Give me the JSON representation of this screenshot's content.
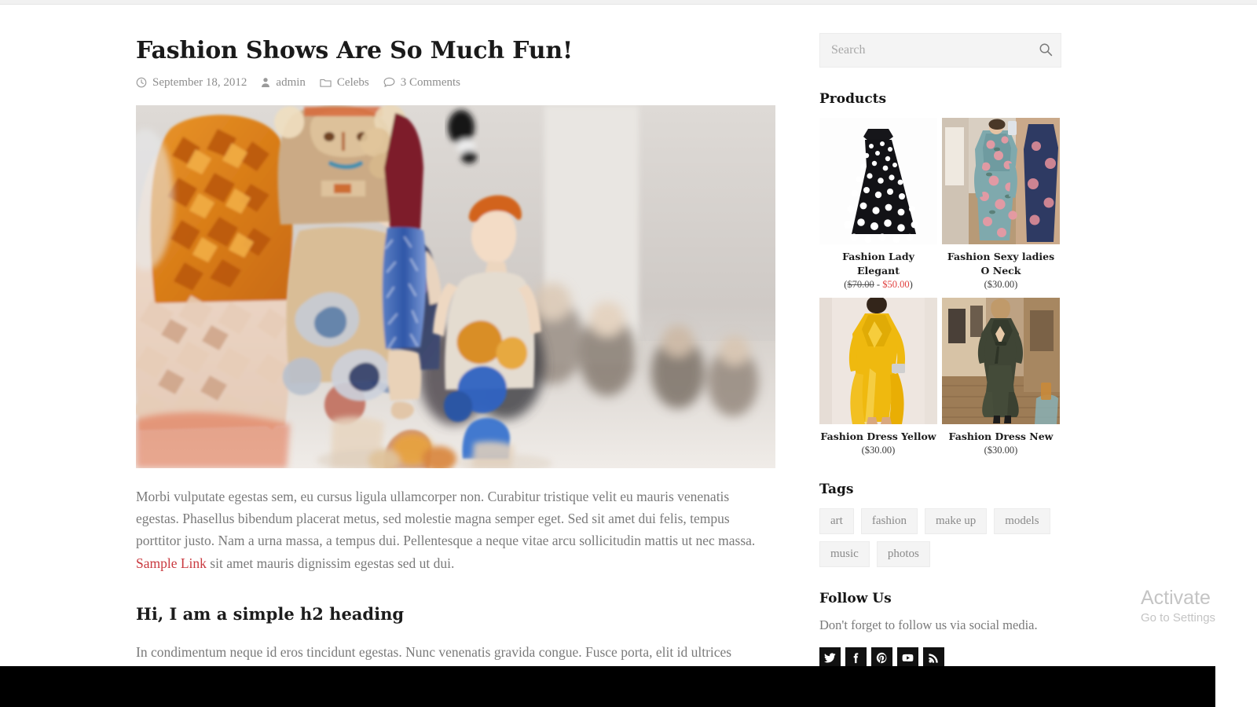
{
  "post": {
    "title": "Fashion Shows Are So Much Fun!",
    "meta": {
      "date": "September 18, 2012",
      "author": "admin",
      "category": "Celebs",
      "comments": "3 Comments",
      "date_icon": "clock-icon",
      "author_icon": "user-icon",
      "category_icon": "folder-icon",
      "comments_icon": "comment-icon"
    },
    "featured_image_alt": "Models walking on a fashion show runway",
    "paragraph_1_before_link": "Morbi vulputate egestas sem, eu cursus ligula ullamcorper non. Curabitur tristique velit eu mauris venenatis egestas. Phasellus bibendum placerat metus, sed molestie magna semper eget. Sed sit amet dui felis, tempus porttitor justo. Nam a urna massa, a tempus dui. Pellentesque a neque vitae arcu sollicitudin mattis ut nec massa. ",
    "paragraph_1_link": "Sample Link",
    "paragraph_1_after_link": " sit amet mauris dignissim egestas sed ut dui.",
    "heading_2": "Hi, I am a simple h2 heading",
    "paragraph_2": "In condimentum neque id eros tincidunt egestas. Nunc venenatis gravida congue. Fusce porta, elit id ultrices bibendum, lectus velit tristique massa, nec bibendum felis ante et metus. Vestibulum ultrices adipiscing turpis quis feugiat. Cras sed"
  },
  "sidebar": {
    "search": {
      "placeholder": "Search",
      "value": "",
      "icon": "search-icon"
    },
    "products": {
      "title": "Products",
      "items": [
        {
          "name": "Fashion Lady Elegant",
          "price_old": "$70.00",
          "price_sep": " - ",
          "price_new": "$50.00",
          "price_open": "(",
          "price_close": ")",
          "on_sale": true,
          "image": "black-white-polka-dot-dress"
        },
        {
          "name": "Fashion Sexy ladies O Neck",
          "price": "($30.00)",
          "on_sale": false,
          "image": "teal-floral-maxi-dress"
        },
        {
          "name": "Fashion Dress Yellow",
          "price": "($30.00)",
          "on_sale": false,
          "image": "yellow-maxi-dress"
        },
        {
          "name": "Fashion Dress New",
          "price": "($30.00)",
          "on_sale": false,
          "image": "olive-green-dress"
        }
      ]
    },
    "tags": {
      "title": "Tags",
      "items": [
        "art",
        "fashion",
        "make up",
        "models",
        "music",
        "photos"
      ]
    },
    "follow": {
      "title": "Follow Us",
      "text": "Don't forget to follow us via social media.",
      "socials": [
        {
          "name": "twitter-icon",
          "label": "Twitter"
        },
        {
          "name": "facebook-icon",
          "label": "Facebook"
        },
        {
          "name": "pinterest-icon",
          "label": "Pinterest"
        },
        {
          "name": "youtube-icon",
          "label": "YouTube"
        },
        {
          "name": "rss-icon",
          "label": "RSS"
        }
      ]
    }
  },
  "watermark": {
    "line1": "Activate Windows",
    "line2": "Go to Settings to activate Windows."
  },
  "colors": {
    "link_red": "#c9393f",
    "sale_red": "#e0403f",
    "text_grey": "#7a7a7a",
    "heading_black": "#1a1a1a",
    "search_bg": "#f4f4f4",
    "footer_black": "#000000"
  }
}
